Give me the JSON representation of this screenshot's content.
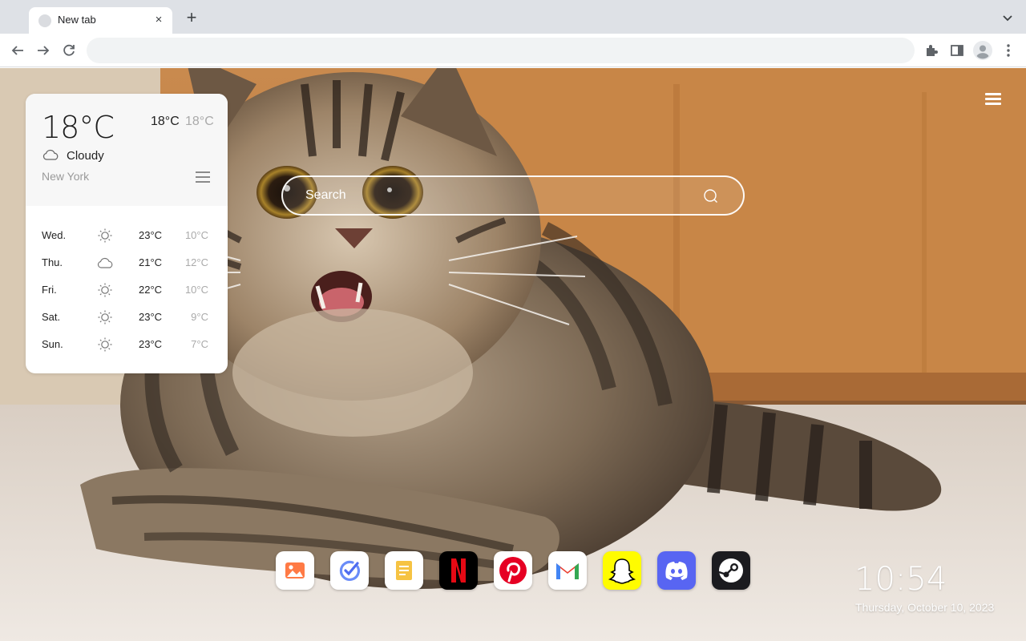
{
  "browser": {
    "tab_title": "New tab",
    "omnibox_value": "",
    "icons": [
      "back-icon",
      "forward-icon",
      "reload-icon",
      "extensions-icon",
      "side-panel-icon",
      "profile-icon",
      "more-icon"
    ]
  },
  "weather": {
    "current_temp": "18°C",
    "high": "18°C",
    "low": "18°C",
    "condition": "Cloudy",
    "condition_icon": "cloud-icon",
    "city": "New York",
    "forecast": [
      {
        "day": "Wed.",
        "icon": "sun-icon",
        "high": "23°C",
        "low": "10°C"
      },
      {
        "day": "Thu.",
        "icon": "cloud-icon",
        "high": "21°C",
        "low": "12°C"
      },
      {
        "day": "Fri.",
        "icon": "sun-icon",
        "high": "22°C",
        "low": "10°C"
      },
      {
        "day": "Sat.",
        "icon": "sun-icon",
        "high": "23°C",
        "low": "9°C"
      },
      {
        "day": "Sun.",
        "icon": "sun-icon",
        "high": "23°C",
        "low": "7°C"
      }
    ]
  },
  "search": {
    "placeholder": "Search"
  },
  "dock": [
    {
      "name": "photos",
      "icon": "photos-icon",
      "color": "#ff6b3d"
    },
    {
      "name": "todo",
      "icon": "todo-icon",
      "color": "#5b7cf7"
    },
    {
      "name": "notes",
      "icon": "notes-icon",
      "color": "#f4b400"
    },
    {
      "name": "netflix",
      "icon": "netflix-icon",
      "color": "#e50914"
    },
    {
      "name": "pinterest",
      "icon": "pinterest-icon",
      "color": "#e60023"
    },
    {
      "name": "gmail",
      "icon": "gmail-icon",
      "color": "#ea4335"
    },
    {
      "name": "snapchat",
      "icon": "snapchat-icon",
      "color": "#fffc00"
    },
    {
      "name": "discord",
      "icon": "discord-icon",
      "color": "#5865f2"
    },
    {
      "name": "steam",
      "icon": "steam-icon",
      "color": "#171a21"
    }
  ],
  "clock": {
    "time": "10:54",
    "date": "Thursday, October 10, 2023"
  }
}
